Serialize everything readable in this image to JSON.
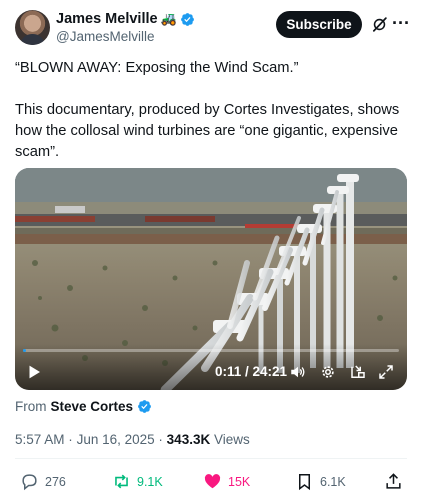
{
  "author": {
    "name": "James Melville",
    "emoji": "🚜",
    "handle": "@JamesMelville"
  },
  "header": {
    "subscribe_label": "Subscribe",
    "more_label": "···"
  },
  "tweet": {
    "paragraph1": "“BLOWN AWAY: Exposing the Wind Scam.”",
    "paragraph2": "This documentary, produced by Cortes Investigates, shows how the collosal wind turbines are “one gigantic, expensive scam”."
  },
  "video": {
    "time": "0:11 / 24:21",
    "progress": 0.0075
  },
  "source": {
    "prefix": "From",
    "name": "Steve Cortes"
  },
  "meta": {
    "time": "5:57 AM",
    "sep1": "·",
    "date": "Jun 16, 2025",
    "sep2": "·",
    "views_count": "343.3K",
    "views_label": "Views"
  },
  "actions": {
    "replies": "276",
    "reposts": "9.1K",
    "likes": "15K",
    "bookmarks": "6.1K"
  },
  "colors": {
    "accent": "#1d9bf0",
    "repost": "#00ba7c",
    "like": "#f91880",
    "muted": "#536471"
  }
}
